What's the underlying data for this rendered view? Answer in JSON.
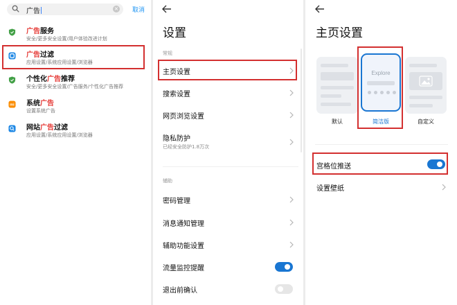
{
  "panel1": {
    "search_query": "广告",
    "cancel_label": "取消",
    "results": [
      {
        "title_pre": "",
        "title_hl": "广告",
        "title_post": "服务",
        "subtitle": "安全/更多安全设置/用户体验改进计划",
        "icon": "shield-icon",
        "icon_color": "#43a047"
      },
      {
        "title_pre": "",
        "title_hl": "广告",
        "title_post": "过滤",
        "subtitle": "应用设置/系统应用设置/浏览器",
        "icon": "browser-icon",
        "icon_color": "#1e88e5"
      },
      {
        "title_pre": "个性化",
        "title_hl": "广告",
        "title_post": "推荐",
        "subtitle": "安全/更多安全设置/广告服务/个性化广告推荐",
        "icon": "shield-icon",
        "icon_color": "#43a047"
      },
      {
        "title_pre": "系统",
        "title_hl": "广告",
        "title_post": "",
        "subtitle": "设置系统广告",
        "icon": "mi-icon",
        "icon_color": "#fb8c00"
      },
      {
        "title_pre": "网站",
        "title_hl": "广告",
        "title_post": "过滤",
        "subtitle": "应用设置/系统应用设置/浏览器",
        "icon": "browser-search-icon",
        "icon_color": "#1e88e5"
      }
    ]
  },
  "panel2": {
    "title": "设置",
    "section1": "常规",
    "rows1": [
      {
        "label": "主页设置"
      },
      {
        "label": "搜索设置"
      },
      {
        "label": "网页浏览设置"
      },
      {
        "label": "隐私防护",
        "sub": "已经安全防护1.8万次"
      }
    ],
    "section2": "辅助",
    "rows2": [
      {
        "label": "密码管理",
        "control": "chevron"
      },
      {
        "label": "消息通知管理",
        "control": "chevron"
      },
      {
        "label": "辅助功能设置",
        "control": "chevron"
      },
      {
        "label": "流量监控提醒",
        "control": "toggle",
        "on": true
      },
      {
        "label": "退出前确认",
        "control": "toggle",
        "on": false
      }
    ]
  },
  "panel3": {
    "title": "主页设置",
    "options": [
      {
        "label": "默认",
        "selected": false
      },
      {
        "label": "简洁版",
        "selected": true,
        "preview_text": "Explore"
      },
      {
        "label": "自定义",
        "selected": false
      }
    ],
    "grid_push_label": "宫格位推送",
    "grid_push_on": true,
    "wallpaper_label": "设置壁纸"
  },
  "colors": {
    "accent": "#1976d2",
    "highlight": "#e53935",
    "outline": "#d32f2f"
  }
}
